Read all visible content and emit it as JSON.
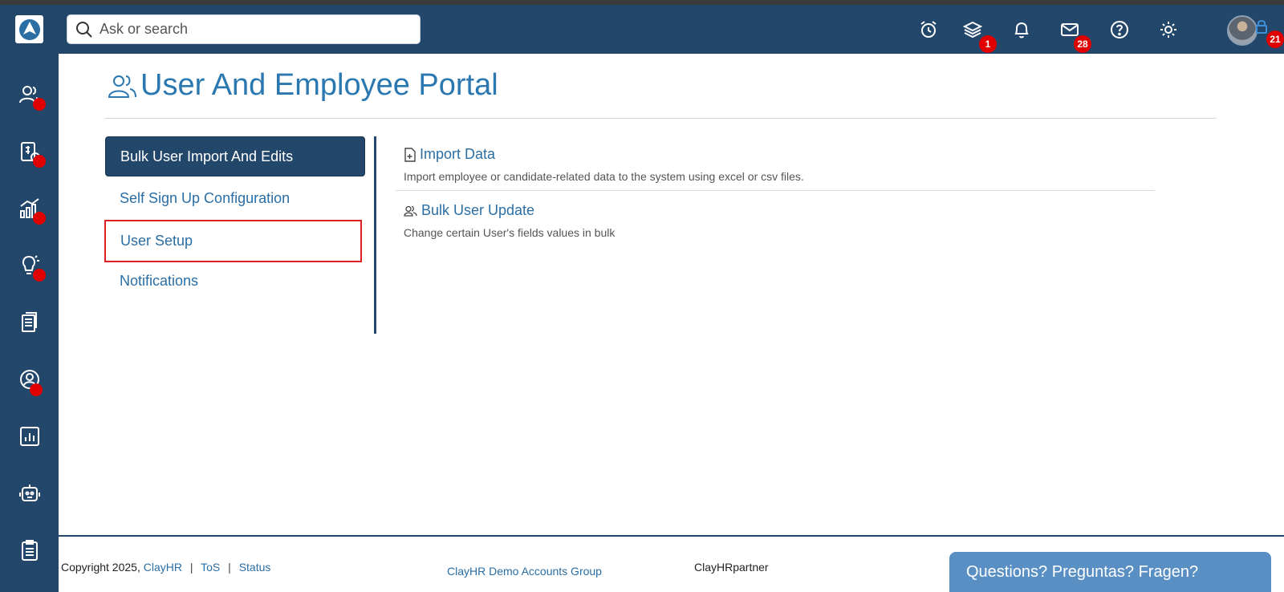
{
  "header": {
    "search_placeholder": "Ask or search",
    "badges": {
      "layers": "1",
      "mail": "28",
      "lock": "21"
    }
  },
  "page": {
    "title": "User And Employee Portal"
  },
  "nav": {
    "items": [
      {
        "label": "Bulk User Import And Edits",
        "state": "active"
      },
      {
        "label": "Self Sign Up Configuration",
        "state": "normal"
      },
      {
        "label": "User Setup",
        "state": "highlighted"
      },
      {
        "label": "Notifications",
        "state": "normal"
      }
    ]
  },
  "cards": [
    {
      "title": "Import Data",
      "description": "Import employee or candidate-related data to the system using excel or csv files."
    },
    {
      "title": "Bulk User Update",
      "description": "Change certain User's fields values in bulk"
    }
  ],
  "footer": {
    "copyright": "Copyright 2025,",
    "brand_link": "ClayHR",
    "tos_link": "ToS",
    "status_link": "Status",
    "group_link": "ClayHR Demo Accounts Group",
    "partner": "ClayHRpartner",
    "chat_label": "Questions? Preguntas? Fragen?"
  },
  "colors": {
    "primary": "#23476b",
    "link": "#2b6ea3",
    "badge": "#e00000",
    "chat": "#5a8fc4"
  }
}
